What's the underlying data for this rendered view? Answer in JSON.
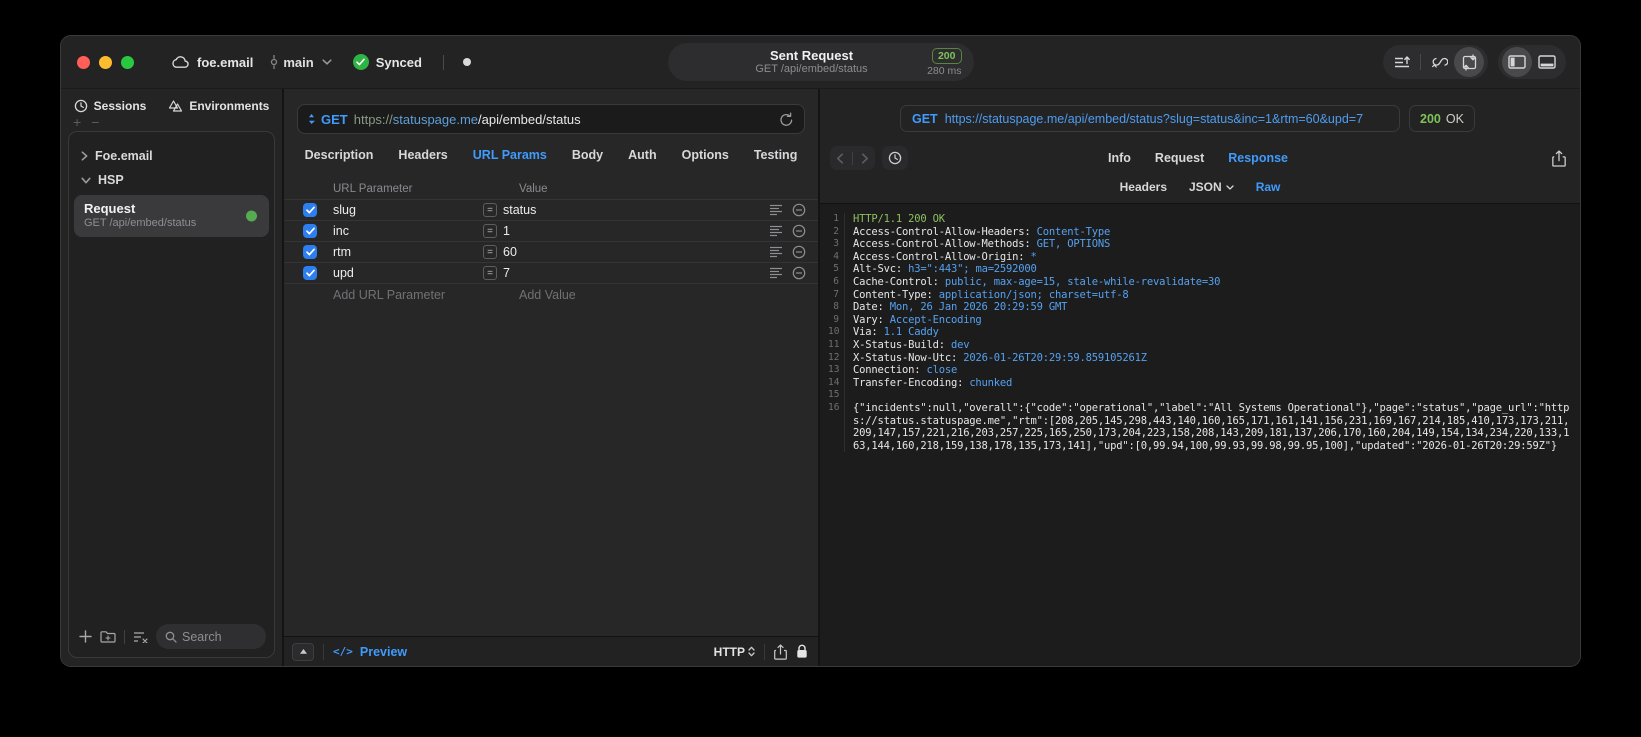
{
  "colors": {
    "accent_blue": "#3f9bfc",
    "status_green": "#7fc25a",
    "checkbox_blue": "#2d7ff0",
    "sync_green": "#2fb344"
  },
  "titlebar": {
    "project": "foe.email",
    "branch": "main",
    "sync_label": "Synced",
    "request_summary": {
      "title": "Sent Request",
      "subtitle": "GET /api/embed/status",
      "status_code": "200",
      "duration": "280 ms"
    }
  },
  "sidebar": {
    "tabs": [
      {
        "label": "Sessions"
      },
      {
        "label": "Environments"
      }
    ],
    "groups": [
      {
        "label": "Foe.email",
        "expanded": false
      },
      {
        "label": "HSP",
        "expanded": true
      }
    ],
    "request_item": {
      "title": "Request",
      "subtitle": "GET /api/embed/status",
      "status_dot": "green"
    },
    "search_placeholder": "Search"
  },
  "request_editor": {
    "method": "GET",
    "url": {
      "scheme": "https://",
      "host": "statuspage.me",
      "path": "/api/embed/status"
    },
    "tabs": [
      "Description",
      "Headers",
      "URL Params",
      "Body",
      "Auth",
      "Options",
      "Testing"
    ],
    "active_tab": "URL Params",
    "params": {
      "col_name": "URL Parameter",
      "col_value": "Value",
      "operator": "=",
      "rows": [
        {
          "name": "slug",
          "value": "status",
          "enabled": true
        },
        {
          "name": "inc",
          "value": "1",
          "enabled": true
        },
        {
          "name": "rtm",
          "value": "60",
          "enabled": true
        },
        {
          "name": "upd",
          "value": "7",
          "enabled": true
        }
      ],
      "add_name": "Add URL Parameter",
      "add_value": "Add Value"
    },
    "footer": {
      "preview": "Preview",
      "code_glyph": "</>",
      "protocol": "HTTP"
    }
  },
  "response_viewer": {
    "request_line": {
      "method": "GET",
      "url": "https://statuspage.me/api/embed/status?slug=status&inc=1&rtm=60&upd=7"
    },
    "status": {
      "code": "200",
      "text": "OK"
    },
    "tabs": [
      "Info",
      "Request",
      "Response"
    ],
    "active_tab": "Response",
    "subtabs": [
      "Headers",
      "JSON",
      "Raw"
    ],
    "active_subtab": "Raw",
    "body_lines": [
      {
        "n": "1",
        "parts": [
          {
            "t": "HTTP/1.1 200 OK",
            "c": "ok"
          }
        ]
      },
      {
        "n": "2",
        "parts": [
          {
            "t": "Access-Control-Allow-Headers: ",
            "c": "hdr"
          },
          {
            "t": "Content-Type",
            "c": "val"
          }
        ]
      },
      {
        "n": "3",
        "parts": [
          {
            "t": "Access-Control-Allow-Methods: ",
            "c": "hdr"
          },
          {
            "t": "GET, OPTIONS",
            "c": "val"
          }
        ]
      },
      {
        "n": "4",
        "parts": [
          {
            "t": "Access-Control-Allow-Origin: ",
            "c": "hdr"
          },
          {
            "t": "*",
            "c": "val"
          }
        ]
      },
      {
        "n": "5",
        "parts": [
          {
            "t": "Alt-Svc: ",
            "c": "hdr"
          },
          {
            "t": "h3=\":443\"; ma=2592000",
            "c": "val"
          }
        ]
      },
      {
        "n": "6",
        "parts": [
          {
            "t": "Cache-Control: ",
            "c": "hdr"
          },
          {
            "t": "public, max-age=15, stale-while-revalidate=30",
            "c": "val"
          }
        ]
      },
      {
        "n": "7",
        "parts": [
          {
            "t": "Content-Type: ",
            "c": "hdr"
          },
          {
            "t": "application/json; charset=utf-8",
            "c": "val"
          }
        ]
      },
      {
        "n": "8",
        "parts": [
          {
            "t": "Date: ",
            "c": "hdr"
          },
          {
            "t": "Mon, 26 Jan 2026 20:29:59 GMT",
            "c": "val"
          }
        ]
      },
      {
        "n": "9",
        "parts": [
          {
            "t": "Vary: ",
            "c": "hdr"
          },
          {
            "t": "Accept-Encoding",
            "c": "val"
          }
        ]
      },
      {
        "n": "10",
        "parts": [
          {
            "t": "Via: ",
            "c": "hdr"
          },
          {
            "t": "1.1 Caddy",
            "c": "val"
          }
        ]
      },
      {
        "n": "11",
        "parts": [
          {
            "t": "X-Status-Build: ",
            "c": "hdr"
          },
          {
            "t": "dev",
            "c": "val"
          }
        ]
      },
      {
        "n": "12",
        "parts": [
          {
            "t": "X-Status-Now-Utc: ",
            "c": "hdr"
          },
          {
            "t": "2026-01-26T20:29:59.859105261Z",
            "c": "val"
          }
        ]
      },
      {
        "n": "13",
        "parts": [
          {
            "t": "Connection: ",
            "c": "hdr"
          },
          {
            "t": "close",
            "c": "val"
          }
        ]
      },
      {
        "n": "14",
        "parts": [
          {
            "t": "Transfer-Encoding: ",
            "c": "hdr"
          },
          {
            "t": "chunked",
            "c": "val"
          }
        ]
      },
      {
        "n": "15",
        "parts": [
          {
            "t": " ",
            "c": "plain"
          }
        ]
      },
      {
        "n": "16",
        "parts": [
          {
            "t": "{\"incidents\":null,\"overall\":{\"code\":\"operational\",\"label\":\"All Systems Operational\"},\"page\":\"status\",\"page_url\":\"https://status.statuspage.me\",\"rtm\":[208,205,145,298,443,140,160,165,171,161,141,156,231,169,167,214,185,410,173,173,211,209,147,157,221,216,203,257,225,165,250,173,204,223,158,208,143,209,181,137,206,170,160,204,149,154,134,234,220,133,163,144,160,218,159,138,178,135,173,141],\"upd\":[0,99.94,100,99.93,99.98,99.95,100],\"updated\":\"2026-01-26T20:29:59Z\"}",
            "c": "plain"
          }
        ]
      }
    ]
  }
}
